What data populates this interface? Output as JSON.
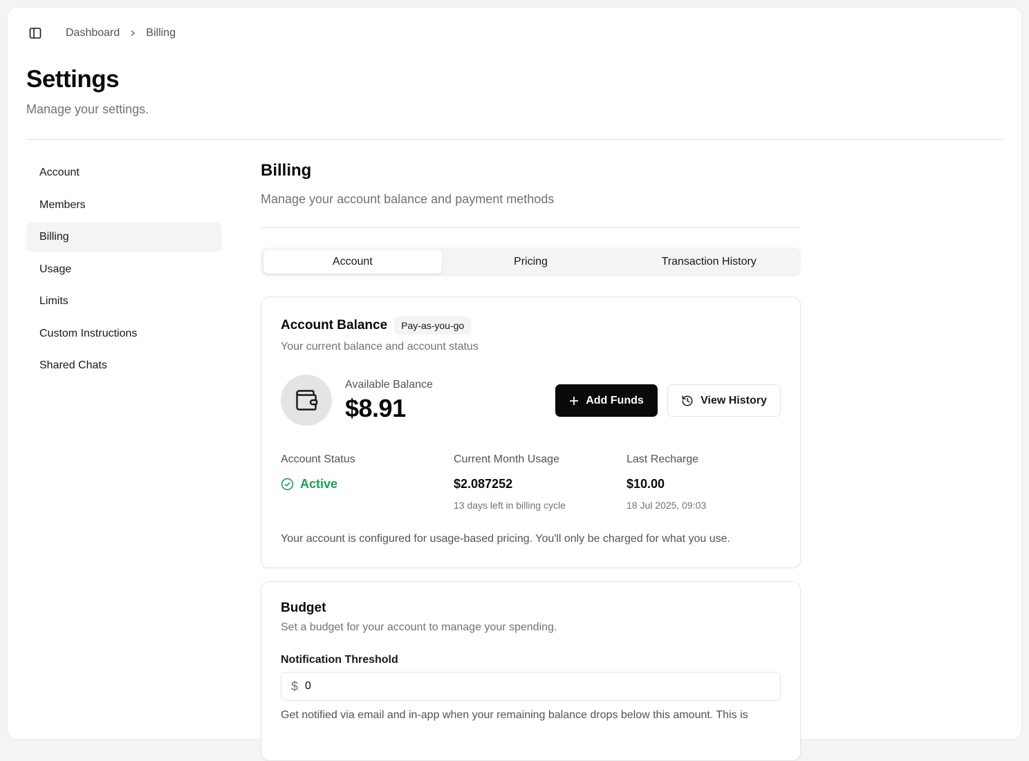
{
  "breadcrumb": {
    "root": "Dashboard",
    "current": "Billing"
  },
  "page": {
    "title": "Settings",
    "subtitle": "Manage your settings."
  },
  "nav": {
    "items": [
      {
        "label": "Account"
      },
      {
        "label": "Members"
      },
      {
        "label": "Billing",
        "active": true
      },
      {
        "label": "Usage"
      },
      {
        "label": "Limits"
      },
      {
        "label": "Custom Instructions"
      },
      {
        "label": "Shared Chats"
      }
    ]
  },
  "billing": {
    "title": "Billing",
    "subtitle": "Manage your account balance and payment methods",
    "tabs": [
      {
        "label": "Account",
        "active": true
      },
      {
        "label": "Pricing"
      },
      {
        "label": "Transaction History"
      }
    ]
  },
  "balance_card": {
    "title": "Account Balance",
    "badge": "Pay-as-you-go",
    "description": "Your current balance and account status",
    "available_label": "Available Balance",
    "available_amount": "$8.91",
    "add_funds_label": "Add Funds",
    "view_history_label": "View History",
    "status": {
      "label": "Account Status",
      "value": "Active",
      "color": "#16a34a"
    },
    "usage": {
      "label": "Current Month Usage",
      "value": "$2.087252",
      "note": "13 days left in billing cycle"
    },
    "recharge": {
      "label": "Last Recharge",
      "value": "$10.00",
      "note": "18 Jul 2025, 09:03"
    },
    "footnote": "Your account is configured for usage-based pricing. You'll only be charged for what you use."
  },
  "budget_card": {
    "title": "Budget",
    "description": "Set a budget for your account to manage your spending.",
    "threshold_label": "Notification Threshold",
    "currency_prefix": "$",
    "threshold_value": "0",
    "help": "Get notified via email and in-app when your remaining balance drops below this amount. This is"
  },
  "icons": {
    "sidebar_toggle": "panel-left-icon",
    "breadcrumb_separator": "chevron-right-icon",
    "wallet": "wallet-icon",
    "add": "plus-icon",
    "history": "history-icon",
    "status": "check-circle-icon"
  }
}
